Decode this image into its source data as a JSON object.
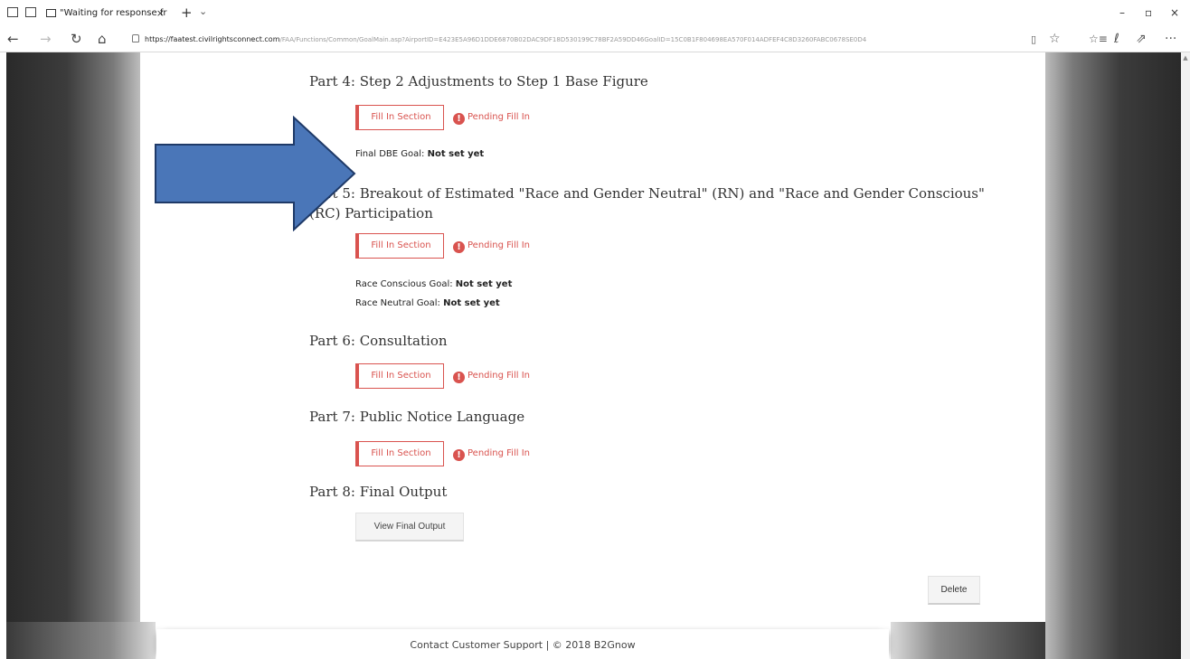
{
  "browser": {
    "tab_title": "\"Waiting for response fr",
    "tab_close": "×",
    "new_tab": "+",
    "tab_list": "⌄",
    "url_host": "https://faatest.civilrightsconnect.com",
    "url_rest": "/FAA/Functions/Common/GoalMain.asp?AirportID=E423E5A96D1DDE6870B02DAC9DF18D530199C78BF2A59DD46GoalID=15C0B1F804698EA570F014ADFEF4C8D3260FABC0678SE0D4",
    "window_buttons": {
      "minimize": "–",
      "maximize": "▫",
      "close": "×"
    },
    "nav": {
      "back": "←",
      "forward": "→",
      "refresh": "↻",
      "home": "⌂"
    },
    "tools": {
      "reading": "▯",
      "favorite": "☆",
      "favorites_hub": "☆≡",
      "notes": "ℓ",
      "share": "⇗",
      "more": "···"
    }
  },
  "sections": [
    {
      "title": "Part 4: Step 2 Adjustments to Step 1 Base Figure",
      "button": "Fill In Section",
      "status": "Pending Fill In"
    },
    {
      "title": "Part 5: Breakout of Estimated \"Race and Gender Neutral\" (RN) and \"Race and Gender Conscious\" (RC) Participation",
      "button": "Fill In Section",
      "status": "Pending Fill In"
    },
    {
      "title": "Part 6: Consultation",
      "button": "Fill In Section",
      "status": "Pending Fill In"
    },
    {
      "title": "Part 7: Public Notice Language",
      "button": "Fill In Section",
      "status": "Pending Fill In"
    },
    {
      "title": "Part 8: Final Output",
      "button": "View Final Output"
    }
  ],
  "goals": {
    "final_dbe_label": "Final DBE Goal: ",
    "final_dbe_value": "Not set yet",
    "race_conscious_label": "Race Conscious Goal: ",
    "race_conscious_value": "Not set yet",
    "race_neutral_label": "Race Neutral Goal: ",
    "race_neutral_value": "Not set yet"
  },
  "status_icon_glyph": "!",
  "delete_label": "Delete",
  "footer": "Contact Customer Support | © 2018 B2Gnow",
  "colors": {
    "accent_red": "#d9534f",
    "arrow_fill": "#4a76b8",
    "arrow_stroke": "#1f3a68"
  },
  "icons": {
    "annotation": "arrow-right-icon",
    "pending": "exclamation-circle-icon"
  }
}
